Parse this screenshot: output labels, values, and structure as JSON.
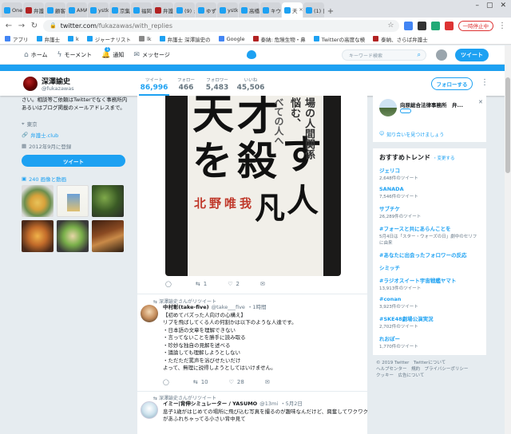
{
  "browser": {
    "tabs": [
      {
        "label": "One",
        "color": "#1da1f2",
        "active": false
      },
      {
        "label": "弁護",
        "color": "#b22222",
        "active": false
      },
      {
        "label": "顧客",
        "color": "#1da1f2",
        "active": false
      },
      {
        "label": "AMA",
        "color": "#1da1f2",
        "active": false
      },
      {
        "label": "ystk",
        "color": "#1da1f2",
        "active": false
      },
      {
        "label": "京集",
        "color": "#1da1f2",
        "active": false
      },
      {
        "label": "福岡",
        "color": "#1da1f2",
        "active": false
      },
      {
        "label": "弁護",
        "color": "#b22222",
        "active": false
      },
      {
        "label": "(9) え",
        "color": "#1da1f2",
        "active": false
      },
      {
        "label": "ゆず",
        "color": "#1da1f2",
        "active": false
      },
      {
        "label": "ystk",
        "color": "#1da1f2",
        "active": false
      },
      {
        "label": "高橋",
        "color": "#1da1f2",
        "active": false
      },
      {
        "label": "キウ",
        "color": "#1da1f2",
        "active": false
      },
      {
        "label": "天",
        "color": "#1da1f2",
        "active": true
      },
      {
        "label": "(1) 日",
        "color": "#1da1f2",
        "active": false
      }
    ],
    "url_host": "twitter.com",
    "url_path": "/fukazawas/with_replies",
    "pause_label": "一時停止中",
    "bookmarks": [
      "アプリ",
      "弁護士",
      "k",
      "ジャーナリスト",
      "lk",
      "弁護士 深澤諭史の",
      "Google",
      "泰納: 危険生物・鼻",
      "Twitterの高度な検",
      "泰納、さらば弁護士"
    ]
  },
  "twitter_nav": {
    "home": "ホーム",
    "moments": "モーメント",
    "notifications": "通知",
    "notif_count": "1",
    "messages": "メッセージ",
    "search_placeholder": "キーワード検索",
    "tweet_button": "ツイート"
  },
  "profile": {
    "name": "深澤諭史",
    "handle": "@fukazawas",
    "stats": [
      {
        "label": "ツイート",
        "value": "86,996",
        "selected": true
      },
      {
        "label": "フォロー",
        "value": "466",
        "selected": false
      },
      {
        "label": "フォロワー",
        "value": "5,483",
        "selected": false
      },
      {
        "label": "いいね",
        "value": "45,506",
        "selected": false
      }
    ],
    "follow_button": "フォローする",
    "bio_line1": "さい。相談等ご依頼はTwitterでなく事務所内",
    "bio_line2": "あるいはブログ掲載のメールアドレスまで。",
    "location": "東京",
    "website": "弁護士.club",
    "joined": "2012年9月に登録",
    "tweet_button": "ツイート",
    "media_label": "240 画像と動画"
  },
  "timeline": {
    "book": {
      "title_a": "天",
      "title_b": "才",
      "title_c": "を",
      "title_d": "殺",
      "title_e": "す",
      "title_f": "凡",
      "title_g": "人",
      "author": "北野唯我",
      "vertical_1": "場の人間関係",
      "vertical_2": "悩む、",
      "vertical_3": "べての人へ"
    },
    "tweet1_actions": {
      "replies": "",
      "retweets": "1",
      "likes": "2"
    },
    "tweet2": {
      "retweeted_by": "深澤諭史さんがリツイート",
      "name": "中村彰(take-five)",
      "handle": "@take___five",
      "time": "・1時間",
      "lines": [
        "【初めてバズった人向けの心構え】",
        "リプを飛ばしてくる人の何割かは以下のような人達です。",
        "・日本語の文章を理解できない",
        "・言ってないことを勝手に読み取る",
        "・珍妙な独自の見解を述べる",
        "・議論しても理解しようとしない",
        "・ただただ罵声を浴びせたいだけ",
        "よって、無理に説得しようとしてはいけません。"
      ],
      "actions": {
        "replies": "",
        "retweets": "10",
        "likes": "28"
      }
    },
    "tweet3": {
      "retweeted_by": "深澤諭史さんがリツイート",
      "name": "イミー|背伸シミュレーター / YASUMO",
      "handle": "@13mi",
      "time": "・5月2日",
      "lines": [
        "息子1歳がはじめての場所に飛び込む写真を撮るのが趣味なんだけど、興奮してワクワク",
        "があふれちゃってる小さい背中見て"
      ]
    }
  },
  "sidebar": {
    "promo_title": "向原総合法律事務所　弁...",
    "promo_link": "知り合いを見つけましょう",
    "trends_title": "おすすめトレンド",
    "trends_change": "・変更する",
    "trends": [
      {
        "name": "ジェリコ",
        "count": "2,648件のツイート"
      },
      {
        "name": "SANADA",
        "count": "7,546件のツイート"
      },
      {
        "name": "サブチケ",
        "count": "26,289件のツイート"
      },
      {
        "name": "#フォースと共にあらんことを",
        "count": "5月4日は「スター・ウォーズの日」劇中のセリフに由来"
      },
      {
        "name": "#あなたに出会ったフォロワーの反応",
        "count": ""
      },
      {
        "name": "シミッチ",
        "count": ""
      },
      {
        "name": "#ラジオスイート宇宙戦艦ヤマト",
        "count": "13,913件のツイート"
      },
      {
        "name": "#conan",
        "count": "3,923件のツイート"
      },
      {
        "name": "#SKE48劇場公演実況",
        "count": "2,702件のツイート"
      },
      {
        "name": "れおぽー",
        "count": "1,770件のツイート"
      }
    ],
    "footer_1": "© 2019 Twitter　Twitterについて",
    "footer_2": "ヘルプセンター　規約　プライバシーポリシー",
    "footer_3": "クッキー　広告について"
  }
}
